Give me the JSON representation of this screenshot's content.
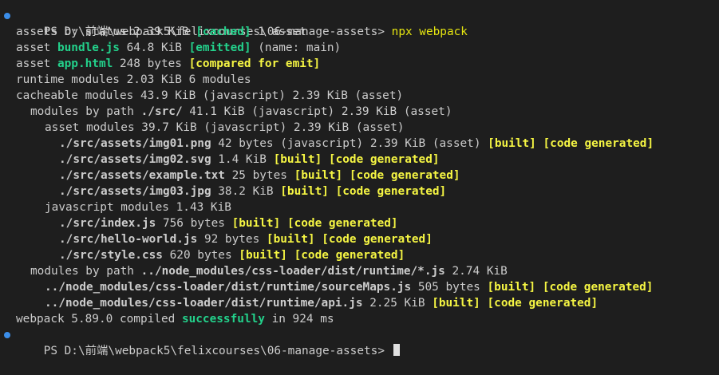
{
  "prompt": {
    "text": "PS D:\\前端\\webpack5\\felixcourses\\06-manage-assets> ",
    "command": "npx webpack"
  },
  "output": {
    "l1": {
      "a": "assets by status 2.39 KiB ",
      "b": "[cached]",
      "c": " 1 asset"
    },
    "l2": {
      "a": "asset ",
      "b": "bundle.js",
      "c": " 64.8 KiB ",
      "d": "[emitted]",
      "e": " (name: main)"
    },
    "l3": {
      "a": "asset ",
      "b": "app.html",
      "c": " 248 bytes ",
      "d": "[compared for emit]"
    },
    "l4": {
      "a": "runtime modules 2.03 KiB 6 modules"
    },
    "l5": {
      "a": "cacheable modules 43.9 KiB (javascript) 2.39 KiB (asset)"
    },
    "l6": {
      "a": "modules by path ",
      "b": "./src/",
      "c": " 41.1 KiB (javascript) 2.39 KiB (asset)"
    },
    "l7": {
      "a": "asset modules 39.7 KiB (javascript) 2.39 KiB (asset)"
    },
    "l8": {
      "a": "./src/assets/img01.png",
      "b": " 42 bytes (javascript) 2.39 KiB (asset) ",
      "c": "[built]",
      "d": " ",
      "e": "[code generated]"
    },
    "l9": {
      "a": "./src/assets/img02.svg",
      "b": " 1.4 KiB ",
      "c": "[built]",
      "d": " ",
      "e": "[code generated]"
    },
    "l10": {
      "a": "./src/assets/example.txt",
      "b": " 25 bytes ",
      "c": "[built]",
      "d": " ",
      "e": "[code generated]"
    },
    "l11": {
      "a": "./src/assets/img03.jpg",
      "b": " 38.2 KiB ",
      "c": "[built]",
      "d": " ",
      "e": "[code generated]"
    },
    "l12": {
      "a": "javascript modules 1.43 KiB"
    },
    "l13": {
      "a": "./src/index.js",
      "b": " 756 bytes ",
      "c": "[built]",
      "d": " ",
      "e": "[code generated]"
    },
    "l14": {
      "a": "./src/hello-world.js",
      "b": " 92 bytes ",
      "c": "[built]",
      "d": " ",
      "e": "[code generated]"
    },
    "l15": {
      "a": "./src/style.css",
      "b": " 620 bytes ",
      "c": "[built]",
      "d": " ",
      "e": "[code generated]"
    },
    "l16": {
      "a": "modules by path ",
      "b": "../node_modules/css-loader/dist/runtime/*.js",
      "c": " 2.74 KiB"
    },
    "l17": {
      "a": "../node_modules/css-loader/dist/runtime/sourceMaps.js",
      "b": " 505 bytes ",
      "c": "[built]",
      "d": " ",
      "e": "[code generated]"
    },
    "l18": {
      "a": "../node_modules/css-loader/dist/runtime/api.js",
      "b": " 2.25 KiB ",
      "c": "[built]",
      "d": " ",
      "e": "[code generated]"
    },
    "l19": {
      "a": "webpack 5.89.0 compiled ",
      "b": "successfully",
      "c": " in 924 ms"
    }
  },
  "final_prompt": {
    "text": "PS D:\\前端\\webpack5\\felixcourses\\06-manage-assets> "
  },
  "colors": {
    "background": "#1e1e1e",
    "foreground": "#cccccc",
    "command": "#e5e510",
    "success": "#23d18b",
    "status": "#f5f543",
    "prompt_dot": "#3b8eea"
  },
  "icons": {
    "prompt_indicator": "circle-dot-icon",
    "cursor": "block-cursor-icon"
  }
}
